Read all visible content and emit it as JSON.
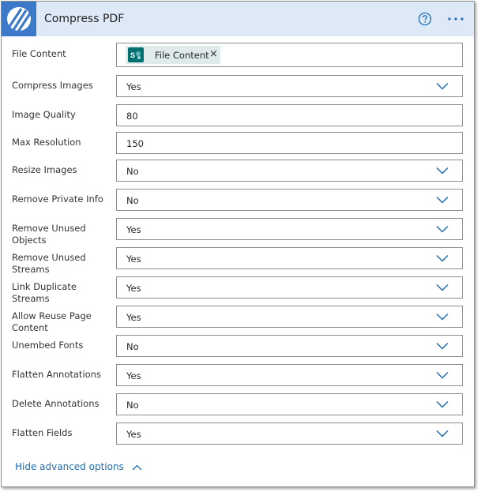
{
  "header": {
    "title": "Compress PDF",
    "logo_icon": "striped-logo-icon",
    "help_icon": "help-circle-icon",
    "more_icon": "more-ellipsis-icon",
    "accent": "#3d79c9",
    "background": "#dde9f7"
  },
  "file_content": {
    "label": "File Content",
    "token_label": "File Content",
    "token_icon": "sharepoint-icon",
    "remove_icon": "close-icon"
  },
  "fields": [
    {
      "label": "Compress Images",
      "value": "Yes",
      "type": "dropdown"
    },
    {
      "label": "Image Quality",
      "value": "80",
      "type": "text"
    },
    {
      "label": "Max Resolution",
      "value": "150",
      "type": "text"
    },
    {
      "label": "Resize Images",
      "value": "No",
      "type": "dropdown"
    },
    {
      "label": "Remove Private Info",
      "value": "No",
      "type": "dropdown"
    },
    {
      "label": "Remove Unused Objects",
      "value": "Yes",
      "type": "dropdown"
    },
    {
      "label": "Remove Unused Streams",
      "value": "Yes",
      "type": "dropdown"
    },
    {
      "label": "Link Duplicate Streams",
      "value": "Yes",
      "type": "dropdown"
    },
    {
      "label": "Allow Reuse Page Content",
      "value": "Yes",
      "type": "dropdown"
    },
    {
      "label": "Unembed Fonts",
      "value": "No",
      "type": "dropdown"
    },
    {
      "label": "Flatten Annotations",
      "value": "Yes",
      "type": "dropdown"
    },
    {
      "label": "Delete Annotations",
      "value": "No",
      "type": "dropdown"
    },
    {
      "label": "Flatten Fields",
      "value": "Yes",
      "type": "dropdown"
    }
  ],
  "footer": {
    "hide_advanced_label": "Hide advanced options",
    "link_color": "#1f6db5"
  }
}
